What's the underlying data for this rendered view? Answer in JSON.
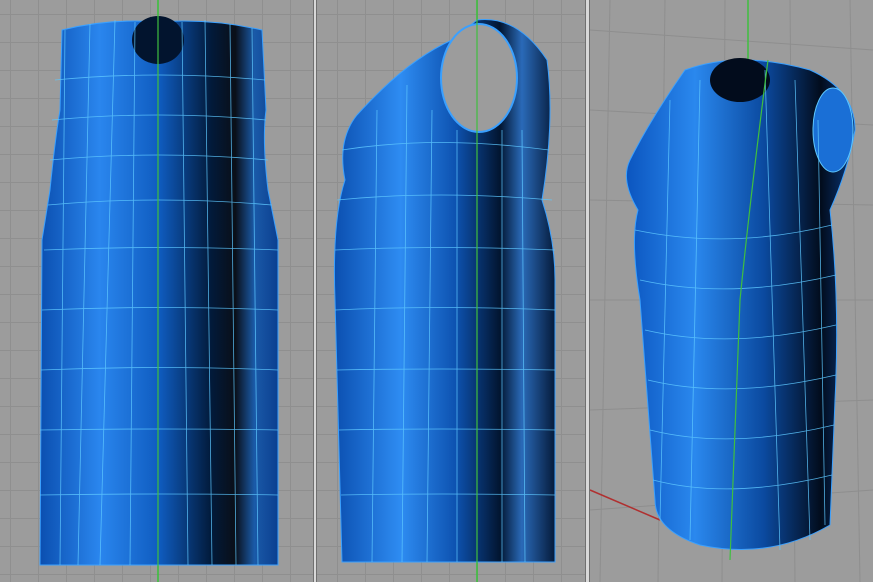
{
  "viewports": [
    {
      "name": "front"
    },
    {
      "name": "right"
    },
    {
      "name": "perspective"
    }
  ],
  "colors": {
    "background": "#9c9c9c",
    "grid": "#8f8f8f",
    "surface": "#1a6fd6",
    "isocurve": "#5ec8ff",
    "axis_y": "#3fbf3f",
    "axis_x": "#b03030"
  }
}
